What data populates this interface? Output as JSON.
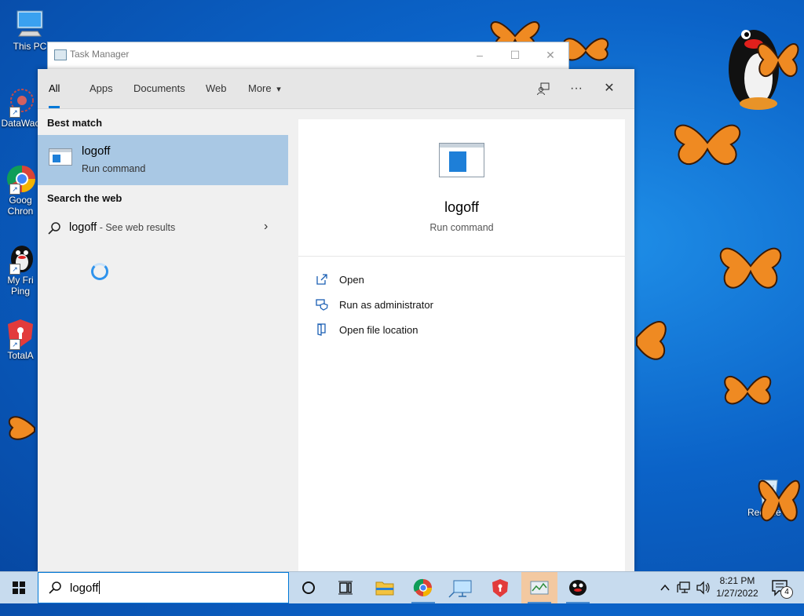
{
  "desktop": {
    "icons": [
      {
        "label": "This PC"
      },
      {
        "label": "DataWac"
      },
      {
        "label": "Goog Chron"
      },
      {
        "label": "My Fri Ping"
      },
      {
        "label": "TotalA"
      },
      {
        "label": "Recycle B"
      }
    ]
  },
  "background_window": {
    "title": "Task Manager"
  },
  "search": {
    "tabs": [
      {
        "label": "All",
        "active": true
      },
      {
        "label": "Apps"
      },
      {
        "label": "Documents"
      },
      {
        "label": "Web"
      },
      {
        "label": "More"
      }
    ],
    "more_chevron": "▾",
    "header_icons": [
      "feedback-icon",
      "more-options-icon",
      "close-icon"
    ],
    "ellipsis": "···",
    "close_glyph": "✕",
    "best_match_label": "Best match",
    "best_match": {
      "title": "logoff",
      "subtitle": "Run command"
    },
    "search_web_label": "Search the web",
    "web_result": {
      "query": "logoff",
      "suffix": " - See web results",
      "chevron": "›"
    },
    "detail": {
      "title": "logoff",
      "subtitle": "Run command",
      "actions": [
        {
          "label": "Open",
          "icon": "open-icon"
        },
        {
          "label": "Run as administrator",
          "icon": "shield-icon"
        },
        {
          "label": "Open file location",
          "icon": "file-location-icon"
        }
      ]
    },
    "query": "logoff"
  },
  "taskbar": {
    "search_text": "logoff",
    "apps": [
      "cortana-icon",
      "task-view-icon",
      "file-explorer-icon",
      "chrome-icon",
      "remote-desktop-icon",
      "totalav-icon",
      "task-manager-icon",
      "pingu-icon"
    ],
    "clock_time": "8:21 PM",
    "clock_date": "1/27/2022",
    "notification_count": "4",
    "colors": {
      "accent": "#0078d7",
      "active_app": "#f3c9a1",
      "taskbar_bg": "#c7dbee",
      "selection": "#a9c8e4"
    }
  }
}
